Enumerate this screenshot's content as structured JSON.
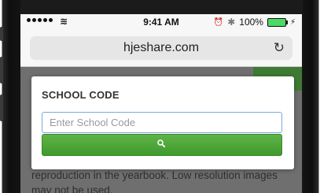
{
  "status_bar": {
    "time": "9:41 AM",
    "battery": "100%",
    "bluetooth_glyph": "✱",
    "wifi_glyph": "≋",
    "alarm_glyph": "⏰",
    "charge_glyph": "⚡",
    "battery_level": 1.0
  },
  "browser": {
    "url": "hjeshare.com",
    "reload_glyph": "↻"
  },
  "modal": {
    "title": "SCHOOL CODE",
    "input_placeholder": "Enter School Code",
    "input_value": ""
  },
  "page": {
    "text": "reproduction in the yearbook. Low resolution images may not be used."
  },
  "colors": {
    "accent_green": "#4ea83a",
    "input_border": "#7aa9d8",
    "overlay": "#6f6f6f"
  }
}
